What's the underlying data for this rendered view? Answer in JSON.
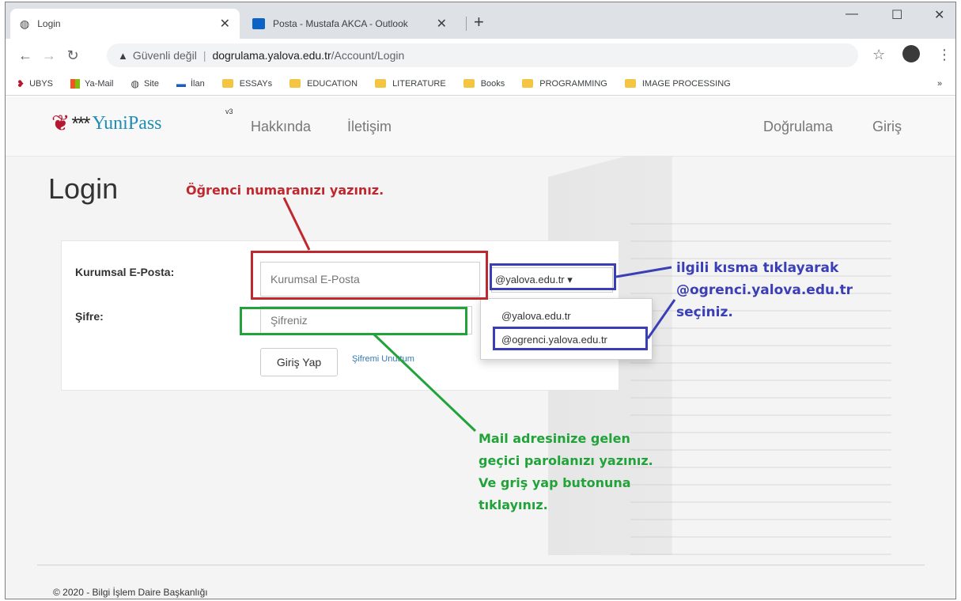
{
  "browser": {
    "tabs": [
      {
        "title": "Login"
      },
      {
        "title": "Posta - Mustafa AKCA - Outlook"
      }
    ],
    "address": {
      "security": "Güvenli değil",
      "host": "dogrulama.yalova.edu.tr",
      "path": "/Account/Login"
    },
    "bookmarks": [
      "UBYS",
      "Ya-Mail",
      "Site",
      "İlan",
      "ESSAYs",
      "EDUCATION",
      "LITERATURE",
      "Books",
      "PROGRAMMING",
      "IMAGE PROCESSING"
    ],
    "bookmarks_overflow": "»"
  },
  "site": {
    "brand": {
      "stars": "***",
      "name": "YuniPass",
      "version": "v3"
    },
    "nav_left": [
      "Hakkında",
      "İletişim"
    ],
    "nav_right": [
      "Doğrulama",
      "Giriş"
    ],
    "page_title": "Login",
    "form": {
      "email_label": "Kurumsal E-Posta:",
      "email_placeholder": "Kurumsal E-Posta",
      "domain_selected": "@yalova.edu.tr ▾",
      "domain_options": [
        "@yalova.edu.tr",
        "@ogrenci.yalova.edu.tr"
      ],
      "password_label": "Şifre:",
      "password_placeholder": "Şifreniz",
      "submit_label": "Giriş Yap",
      "forgot_label": "Şifremi Unuttum"
    },
    "footer": "© 2020 - Bilgi İşlem Daire Başkanlığı"
  },
  "annotations": {
    "red": "Öğrenci numaranızı yazınız.",
    "blue": [
      "ilgili kısma tıklayarak",
      "@ogrenci.yalova.edu.tr",
      "seçiniz."
    ],
    "green": [
      "Mail adresinize gelen",
      "geçici parolanızı yazınız.",
      "Ve griş yap butonuna",
      "tıklayınız."
    ],
    "colors": {
      "red": "#c0282f",
      "blue": "#3a3fb5",
      "green": "#21a33a"
    }
  }
}
